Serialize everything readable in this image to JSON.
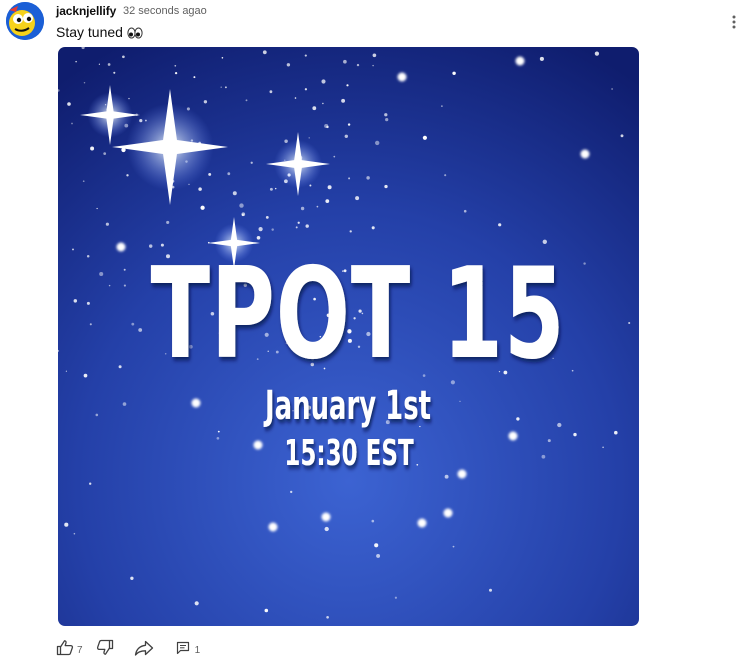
{
  "post": {
    "author": "jacknjellify",
    "timestamp": "32 seconds agao",
    "text": "Stay tuned",
    "emoji_icon": "eyes-emoji"
  },
  "media": {
    "title": "TPOT 15",
    "date": "January 1st",
    "time": "15:30 EST",
    "colors": {
      "background_dark": "#0e1e6e",
      "background_light": "#3a5fd0",
      "stars": "#ffffff"
    }
  },
  "actions": {
    "like_icon": "thumbs-up-icon",
    "like_count": "7",
    "dislike_icon": "thumbs-down-icon",
    "share_icon": "share-icon",
    "reply_icon": "reply-icon",
    "reply_count": "1",
    "menu_icon": "more-vert-icon"
  }
}
